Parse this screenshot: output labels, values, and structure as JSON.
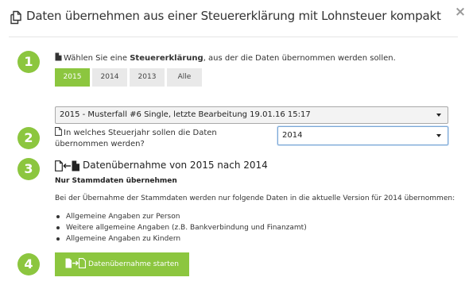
{
  "dialog": {
    "title": "Daten übernehmen aus einer Steuererklärung mit Lohnsteuer kompakt",
    "title_icon": "copy-icon",
    "close_icon": "close-icon",
    "close_glyph": "×"
  },
  "steps": {
    "step1_number": "1",
    "step2_number": "2",
    "step3_number": "3",
    "step4_number": "4"
  },
  "step1": {
    "instruction_prefix": "Wählen Sie eine ",
    "instruction_bold": "Steuererklärung",
    "instruction_suffix": ", aus der die Daten übernommen werden sollen.",
    "year_tabs": [
      {
        "label": "2015",
        "active": true
      },
      {
        "label": "2014",
        "active": false
      },
      {
        "label": "2013",
        "active": false
      },
      {
        "label": "Alle",
        "active": false
      }
    ],
    "return_select_value": "2015 - Musterfall #6 Single, letzte Bearbeitung 19.01.16 15:17"
  },
  "step2": {
    "question": "In welches Steuerjahr sollen die Daten übernommen werden?",
    "target_year_value": "2014"
  },
  "step3": {
    "transfer_title": "Datenübernahme von 2015 nach 2014",
    "sub_heading": "Nur Stammdaten übernehmen",
    "description": "Bei der Übernahme der Stammdaten werden nur folgende Daten in die aktuelle Version für 2014 übernommen:",
    "items": [
      "Allgemeine Angaben zur Person",
      "Weitere allgemeine Angaben (z.B. Bankverbindung und Finanzamt)",
      "Allgemeine Angaben zu Kindern"
    ]
  },
  "step4": {
    "button_label": "Datenübernahme starten"
  },
  "colors": {
    "accent": "#8cc63f",
    "tab_inactive": "#e9e9e9",
    "text": "#333333"
  }
}
